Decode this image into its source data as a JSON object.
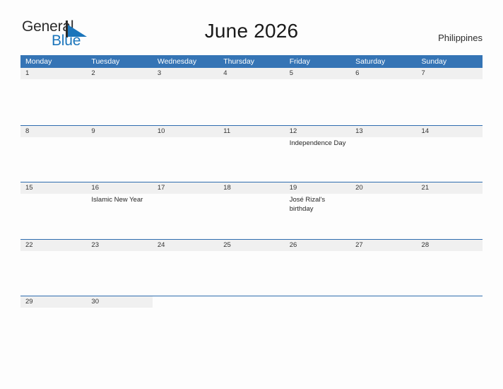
{
  "brand": {
    "name_part1": "General",
    "name_part2": "Blue",
    "accent_color": "#1b75bb",
    "triangle_icon": "triangle-flag-icon"
  },
  "header": {
    "title": "June 2026",
    "country": "Philippines"
  },
  "calendar": {
    "header_bg": "#3574b5",
    "daynum_band_bg": "#f0f0f0",
    "grid_line_color": "#2f6daf",
    "weekdays": [
      "Monday",
      "Tuesday",
      "Wednesday",
      "Thursday",
      "Friday",
      "Saturday",
      "Sunday"
    ],
    "weeks": [
      {
        "partial": false,
        "days": [
          {
            "num": "1",
            "event": ""
          },
          {
            "num": "2",
            "event": ""
          },
          {
            "num": "3",
            "event": ""
          },
          {
            "num": "4",
            "event": ""
          },
          {
            "num": "5",
            "event": ""
          },
          {
            "num": "6",
            "event": ""
          },
          {
            "num": "7",
            "event": ""
          }
        ]
      },
      {
        "partial": false,
        "days": [
          {
            "num": "8",
            "event": ""
          },
          {
            "num": "9",
            "event": ""
          },
          {
            "num": "10",
            "event": ""
          },
          {
            "num": "11",
            "event": ""
          },
          {
            "num": "12",
            "event": "Independence Day"
          },
          {
            "num": "13",
            "event": ""
          },
          {
            "num": "14",
            "event": ""
          }
        ]
      },
      {
        "partial": false,
        "days": [
          {
            "num": "15",
            "event": ""
          },
          {
            "num": "16",
            "event": "Islamic New Year"
          },
          {
            "num": "17",
            "event": ""
          },
          {
            "num": "18",
            "event": ""
          },
          {
            "num": "19",
            "event": "José Rizal's birthday"
          },
          {
            "num": "20",
            "event": ""
          },
          {
            "num": "21",
            "event": ""
          }
        ]
      },
      {
        "partial": false,
        "days": [
          {
            "num": "22",
            "event": ""
          },
          {
            "num": "23",
            "event": ""
          },
          {
            "num": "24",
            "event": ""
          },
          {
            "num": "25",
            "event": ""
          },
          {
            "num": "26",
            "event": ""
          },
          {
            "num": "27",
            "event": ""
          },
          {
            "num": "28",
            "event": ""
          }
        ]
      },
      {
        "partial": true,
        "band_width_cols": 2,
        "days": [
          {
            "num": "29",
            "event": ""
          },
          {
            "num": "30",
            "event": ""
          },
          {
            "num": "",
            "event": ""
          },
          {
            "num": "",
            "event": ""
          },
          {
            "num": "",
            "event": ""
          },
          {
            "num": "",
            "event": ""
          },
          {
            "num": "",
            "event": ""
          }
        ]
      }
    ]
  }
}
